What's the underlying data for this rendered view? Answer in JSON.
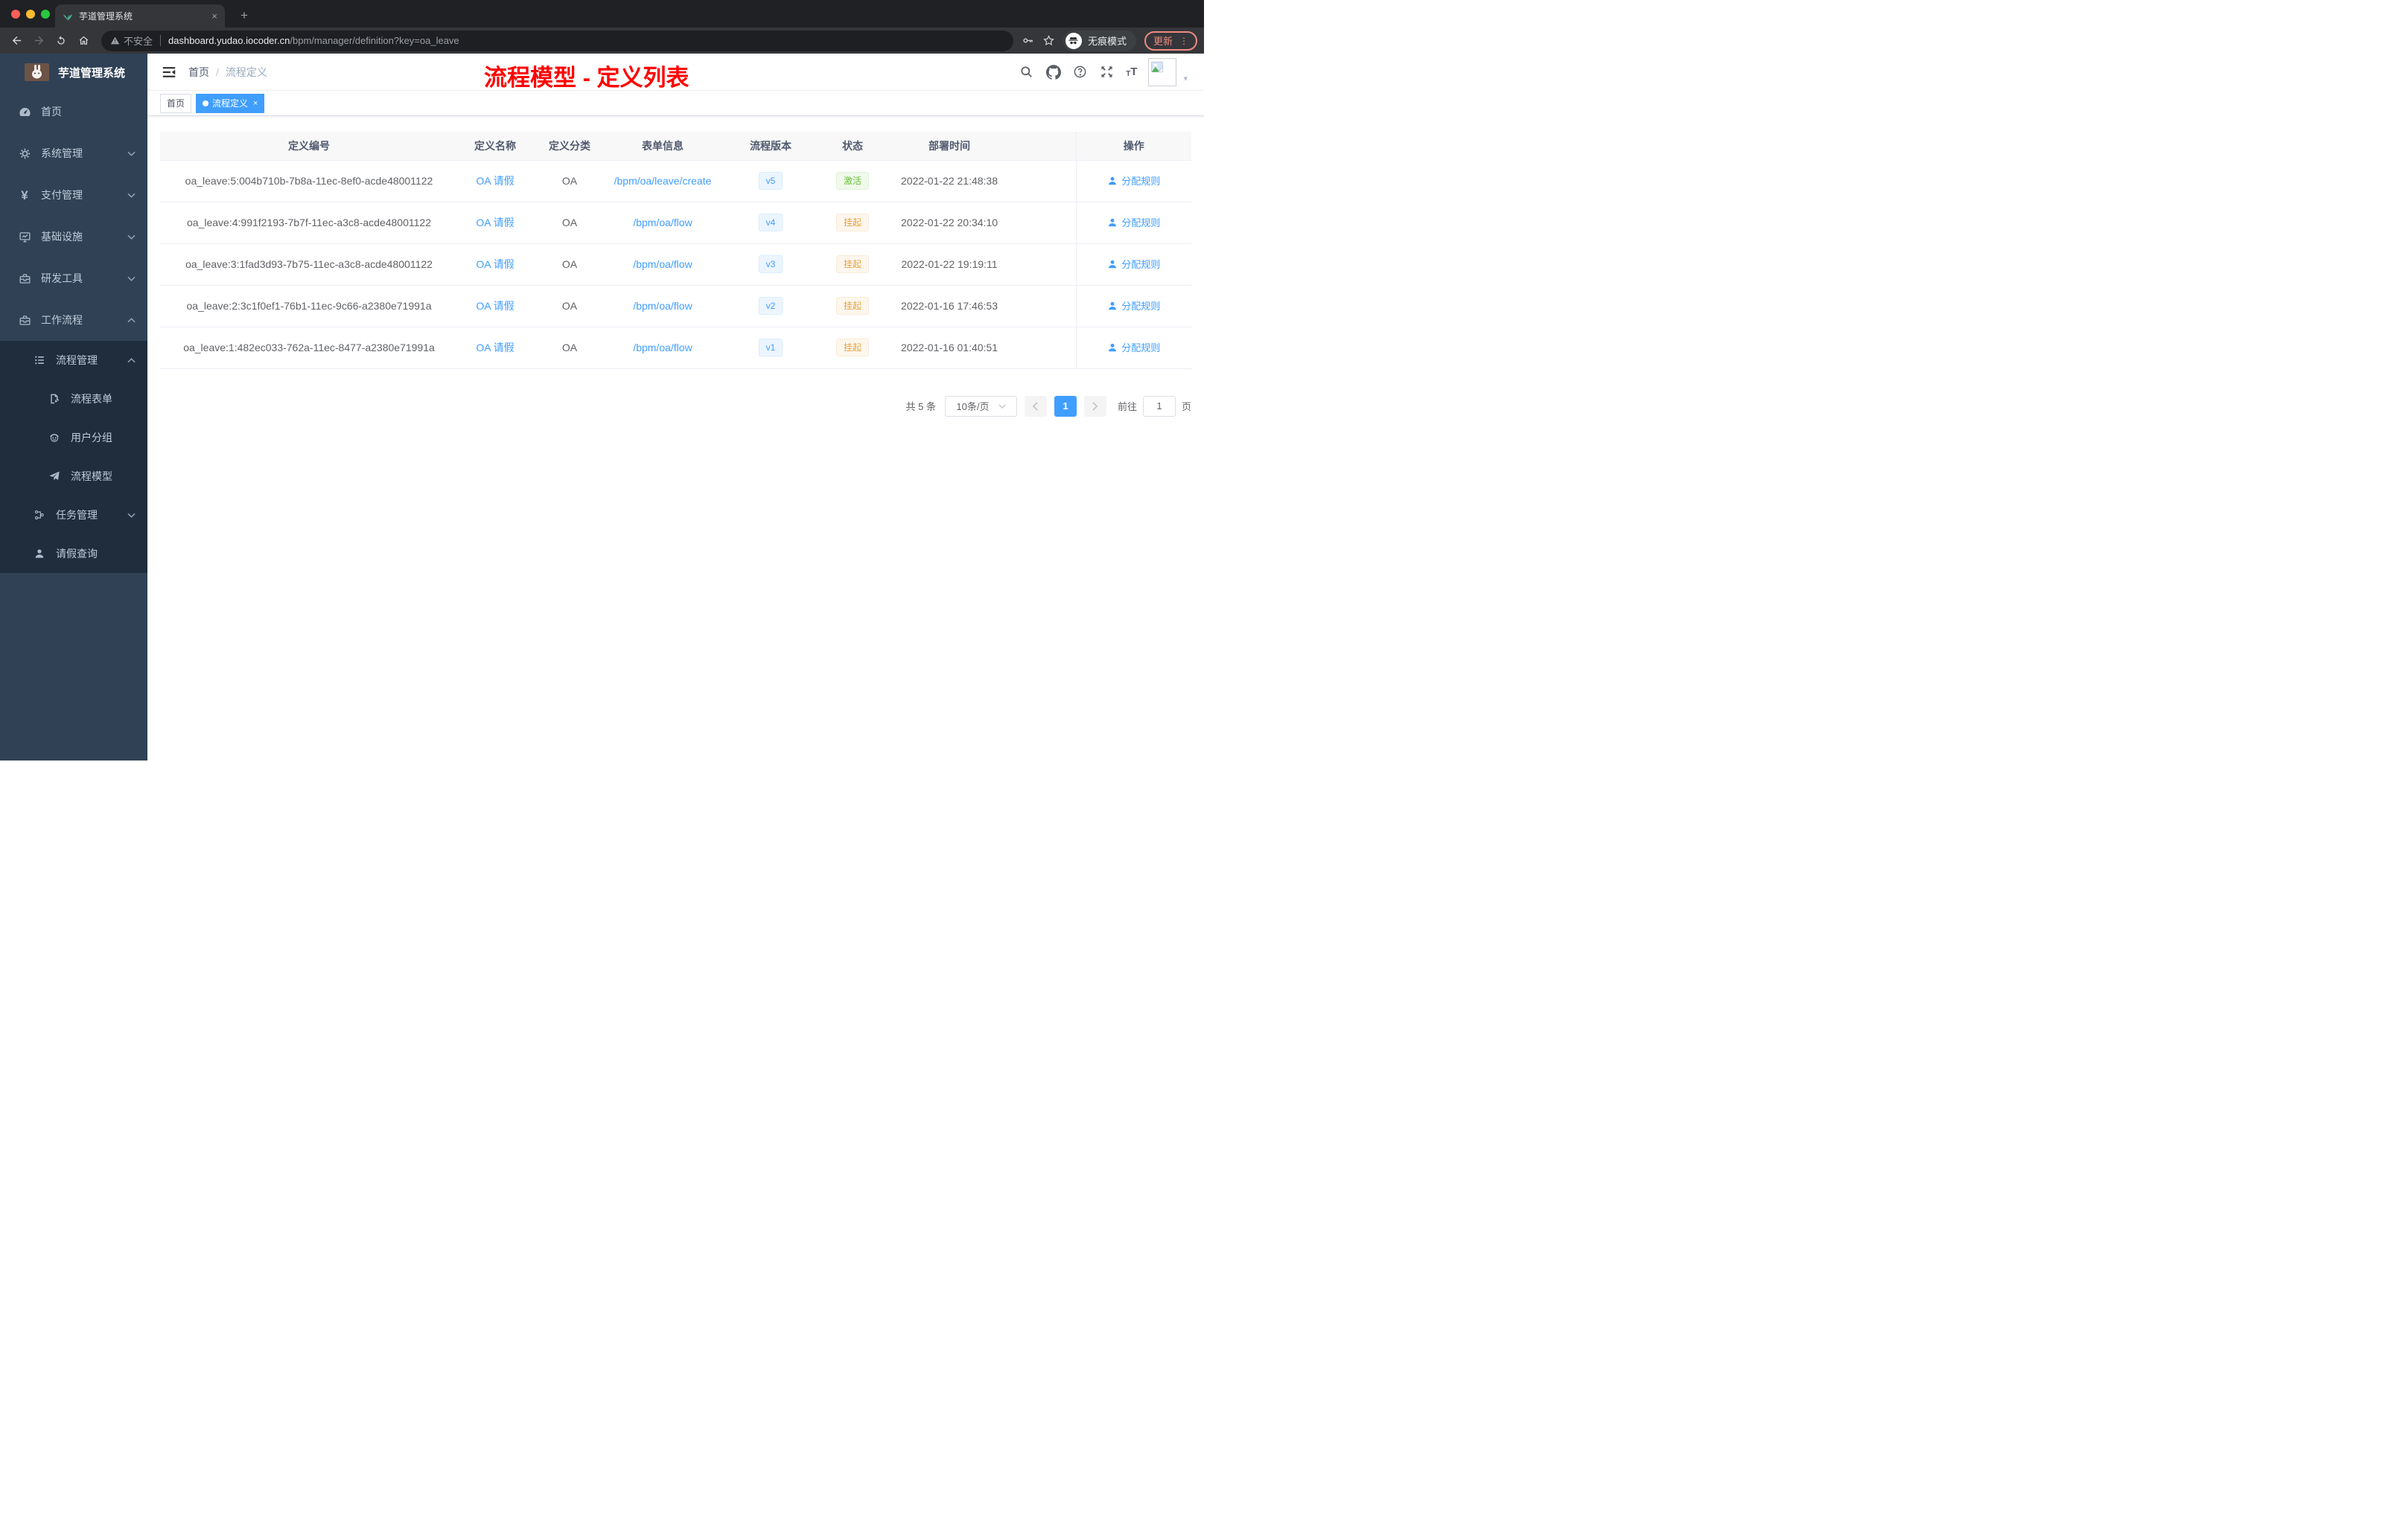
{
  "browser": {
    "tab_title": "芋道管理系统",
    "tab_close": "×",
    "new_tab": "+",
    "security_label": "不安全",
    "url_domain": "dashboard.yudao.iocoder.cn",
    "url_path": "/bpm/manager/definition?key=oa_leave",
    "incognito_label": "无痕模式",
    "update_label": "更新",
    "menu_dots": "⋮",
    "traffic_colors": {
      "close": "#ff5f57",
      "minimize": "#febc2e",
      "zoom": "#28c840"
    }
  },
  "annotation": {
    "text": "流程模型 - 定义列表",
    "color": "#ff0000"
  },
  "sidebar": {
    "title": "芋道管理系统",
    "menu": [
      {
        "label": "首页"
      },
      {
        "label": "系统管理"
      },
      {
        "label": "支付管理"
      },
      {
        "label": "基础设施"
      },
      {
        "label": "研发工具"
      },
      {
        "label": "工作流程"
      }
    ],
    "submenu": [
      {
        "label": "流程管理"
      },
      {
        "label": "流程表单"
      },
      {
        "label": "用户分组"
      },
      {
        "label": "流程模型"
      },
      {
        "label": "任务管理"
      },
      {
        "label": "请假查询"
      }
    ],
    "yen_glyph": "¥"
  },
  "navbar": {
    "breadcrumb_home": "首页",
    "breadcrumb_sep": "/",
    "breadcrumb_current": "流程定义"
  },
  "tags": {
    "home": "首页",
    "active": "流程定义",
    "close": "×"
  },
  "table": {
    "columns": [
      "定义编号",
      "定义名称",
      "定义分类",
      "表单信息",
      "流程版本",
      "状态",
      "部署时间",
      "操作"
    ],
    "action_label": "分配规则",
    "rows": [
      {
        "id": "oa_leave:5:004b710b-7b8a-11ec-8ef0-acde48001122",
        "name": "OA 请假",
        "category": "OA",
        "form": "/bpm/oa/leave/create",
        "version": "v5",
        "status": "激活",
        "status_type": "success",
        "deploy_time": "2022-01-22 21:48:38"
      },
      {
        "id": "oa_leave:4:991f2193-7b7f-11ec-a3c8-acde48001122",
        "name": "OA 请假",
        "category": "OA",
        "form": "/bpm/oa/flow",
        "version": "v4",
        "status": "挂起",
        "status_type": "warning",
        "deploy_time": "2022-01-22 20:34:10"
      },
      {
        "id": "oa_leave:3:1fad3d93-7b75-11ec-a3c8-acde48001122",
        "name": "OA 请假",
        "category": "OA",
        "form": "/bpm/oa/flow",
        "version": "v3",
        "status": "挂起",
        "status_type": "warning",
        "deploy_time": "2022-01-22 19:19:11"
      },
      {
        "id": "oa_leave:2:3c1f0ef1-76b1-11ec-9c66-a2380e71991a",
        "name": "OA 请假",
        "category": "OA",
        "form": "/bpm/oa/flow",
        "version": "v2",
        "status": "挂起",
        "status_type": "warning",
        "deploy_time": "2022-01-16 17:46:53"
      },
      {
        "id": "oa_leave:1:482ec033-762a-11ec-8477-a2380e71991a",
        "name": "OA 请假",
        "category": "OA",
        "form": "/bpm/oa/flow",
        "version": "v1",
        "status": "挂起",
        "status_type": "warning",
        "deploy_time": "2022-01-16 01:40:51"
      }
    ]
  },
  "pagination": {
    "total": "共 5 条",
    "page_size": "10条/页",
    "prev": "‹",
    "page": "1",
    "next": "›",
    "goto_label": "前往",
    "goto_value": "1",
    "goto_suffix": "页"
  },
  "colors": {
    "primary": "#409eff",
    "success": "#67c23a",
    "warning": "#e6a23c",
    "sidebar_bg": "#304156",
    "submenu_bg": "#1f2d3d",
    "table_header_bg": "#f8f8f9"
  }
}
